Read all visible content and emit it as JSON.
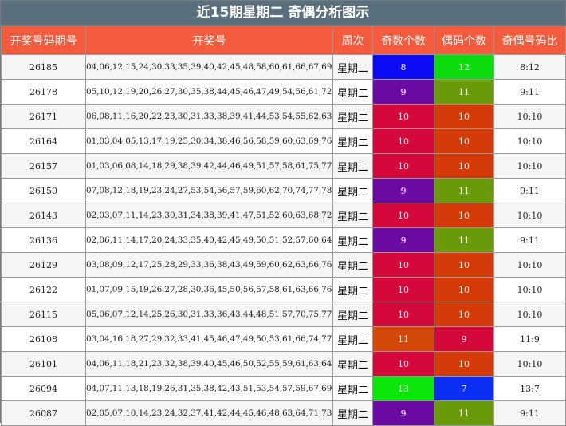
{
  "title": "近15期星期二 奇偶分析图示",
  "headers": [
    "开奖号码期号",
    "开奖号",
    "周次",
    "奇数个数",
    "偶码个数",
    "奇偶号码比"
  ],
  "colors": {
    "8": "#0b0bf5",
    "12": "#0bdc0b",
    "9": "#6a0aa0",
    "11": "#6a9a0a",
    "10a": "#d4083a",
    "10b": "#d43a08",
    "13": "#0be60b",
    "7": "#0b2ef5",
    "11odd": "#d4490a",
    "9even": "#d4083a"
  },
  "rows": [
    {
      "issue": "26185",
      "numbers": "04,06,12,15,24,30,33,35,39,40,42,45,48,58,60,61,66,67,69,80",
      "week": "星期二",
      "odd": "8",
      "even": "12",
      "ratio": "8:12",
      "oddColor": "#0b0bf5",
      "evenColor": "#0bdc0b"
    },
    {
      "issue": "26178",
      "numbers": "05,10,12,19,20,26,27,30,35,38,44,45,46,47,49,54,56,61,72,77",
      "week": "星期二",
      "odd": "9",
      "even": "11",
      "ratio": "9:11",
      "oddColor": "#6a0aa0",
      "evenColor": "#6a9a0a"
    },
    {
      "issue": "26171",
      "numbers": "06,08,11,16,20,22,23,30,31,33,38,39,41,44,53,54,55,62,63,79",
      "week": "星期二",
      "odd": "10",
      "even": "10",
      "ratio": "10:10",
      "oddColor": "#d4083a",
      "evenColor": "#d43a08"
    },
    {
      "issue": "26164",
      "numbers": "01,03,04,05,13,17,19,25,30,34,38,46,56,58,59,60,63,69,76,80",
      "week": "星期二",
      "odd": "10",
      "even": "10",
      "ratio": "10:10",
      "oddColor": "#d4083a",
      "evenColor": "#d43a08"
    },
    {
      "issue": "26157",
      "numbers": "01,03,06,08,14,18,29,38,39,42,44,46,49,51,57,58,61,75,77,80",
      "week": "星期二",
      "odd": "10",
      "even": "10",
      "ratio": "10:10",
      "oddColor": "#d4083a",
      "evenColor": "#d43a08"
    },
    {
      "issue": "26150",
      "numbers": "07,08,12,18,19,23,24,27,53,54,56,57,59,60,62,70,74,77,78,79",
      "week": "星期二",
      "odd": "9",
      "even": "11",
      "ratio": "9:11",
      "oddColor": "#6a0aa0",
      "evenColor": "#6a9a0a"
    },
    {
      "issue": "26143",
      "numbers": "02,03,07,11,14,23,30,31,34,38,39,41,47,51,52,60,63,68,72,78",
      "week": "星期二",
      "odd": "10",
      "even": "10",
      "ratio": "10:10",
      "oddColor": "#d4083a",
      "evenColor": "#d43a08"
    },
    {
      "issue": "26136",
      "numbers": "02,06,11,14,17,20,24,33,35,40,42,45,49,50,51,52,57,60,64,75",
      "week": "星期二",
      "odd": "9",
      "even": "11",
      "ratio": "9:11",
      "oddColor": "#6a0aa0",
      "evenColor": "#6a9a0a"
    },
    {
      "issue": "26129",
      "numbers": "03,08,09,12,17,25,28,29,33,36,38,43,49,59,60,62,63,66,76,78",
      "week": "星期二",
      "odd": "10",
      "even": "10",
      "ratio": "10:10",
      "oddColor": "#d4083a",
      "evenColor": "#d43a08"
    },
    {
      "issue": "26122",
      "numbers": "01,07,09,15,19,26,27,28,30,36,45,50,56,57,58,61,63,66,76,78",
      "week": "星期二",
      "odd": "10",
      "even": "10",
      "ratio": "10:10",
      "oddColor": "#d4083a",
      "evenColor": "#d43a08"
    },
    {
      "issue": "26115",
      "numbers": "05,06,07,12,14,25,26,30,31,33,36,43,44,48,51,57,70,75,77,80",
      "week": "星期二",
      "odd": "10",
      "even": "10",
      "ratio": "10:10",
      "oddColor": "#d4083a",
      "evenColor": "#d43a08"
    },
    {
      "issue": "26108",
      "numbers": "03,04,16,18,27,29,32,33,41,45,46,47,49,50,53,61,66,74,77,80",
      "week": "星期二",
      "odd": "11",
      "even": "9",
      "ratio": "11:9",
      "oddColor": "#d4490a",
      "evenColor": "#d4083a"
    },
    {
      "issue": "26101",
      "numbers": "04,06,11,18,21,23,32,38,39,40,45,46,50,52,55,59,61,63,64,67",
      "week": "星期二",
      "odd": "10",
      "even": "10",
      "ratio": "10:10",
      "oddColor": "#d4083a",
      "evenColor": "#d43a08"
    },
    {
      "issue": "26094",
      "numbers": "04,07,11,13,18,19,26,31,35,38,42,43,51,53,54,57,59,67,69,74",
      "week": "星期二",
      "odd": "13",
      "even": "7",
      "ratio": "13:7",
      "oddColor": "#0be60b",
      "evenColor": "#0b2ef5"
    },
    {
      "issue": "26087",
      "numbers": "02,05,07,10,14,23,24,32,37,41,42,44,45,46,48,63,64,71,73,76",
      "week": "星期二",
      "odd": "9",
      "even": "11",
      "ratio": "9:11",
      "oddColor": "#6a0aa0",
      "evenColor": "#6a9a0a"
    }
  ]
}
